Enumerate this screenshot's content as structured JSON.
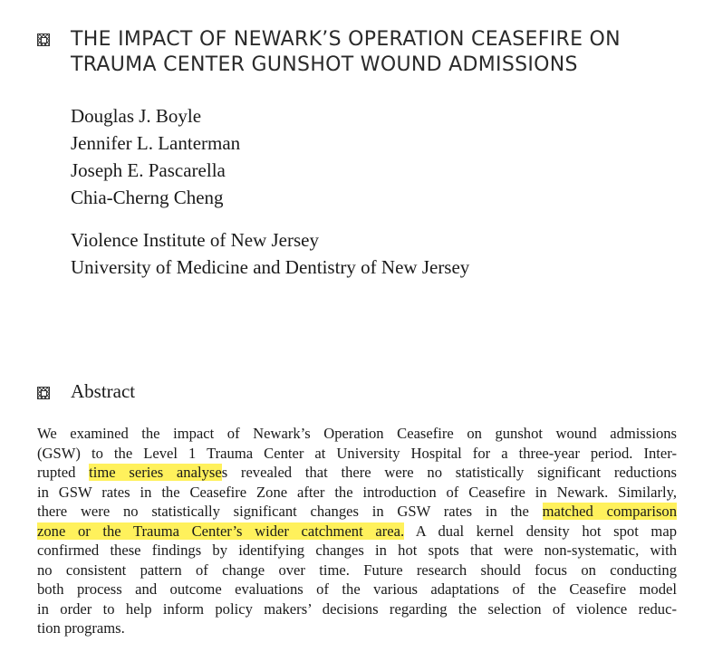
{
  "title": {
    "lines": [
      "THE IMPACT OF NEWARK’S OPERATION CEASEFIRE ON",
      "TRAUMA CENTER GUNSHOT WOUND ADMISSIONS"
    ]
  },
  "authors": [
    "Douglas J. Boyle",
    "Jennifer L. Lanterman",
    "Joseph E. Pascarella",
    "Chia-Cherng Cheng"
  ],
  "affiliations": [
    "Violence Institute of New Jersey",
    "University of Medicine and Dentistry of New Jersey"
  ],
  "abstract": {
    "heading": "Abstract",
    "highlight_color": "#fff15c",
    "l1": "We examined the impact of Newark’s Operation Ceasefire on gunshot wound admissions",
    "l2": "(GSW) to the Level 1 Trauma Center at University Hospital for a three-year period. Inter-",
    "l3a": "rupted ",
    "l3h": "time series analyse",
    "l3b": "s revealed that there were no statistically significant reductions",
    "l4": "in GSW rates in the Ceasefire Zone after the introduction of Ceasefire in Newark. Similarly,",
    "l5a": "there were no statistically significant changes in GSW rates in the ",
    "l5h": "matched comparison",
    "l6h": "zone or the Trauma Center’s wider catchment area.",
    "l6b": " A dual kernel density hot spot map",
    "l7": "confirmed these findings by identifying changes in hot spots that were non-systematic, with",
    "l8": "no consistent pattern of change over time. Future research should focus on conducting",
    "l9": "both process and outcome evaluations of the various adaptations of the Ceasefire model",
    "l10": "in order to help inform policy makers’ decisions regarding the selection of violence reduc-",
    "l11": "tion programs."
  }
}
